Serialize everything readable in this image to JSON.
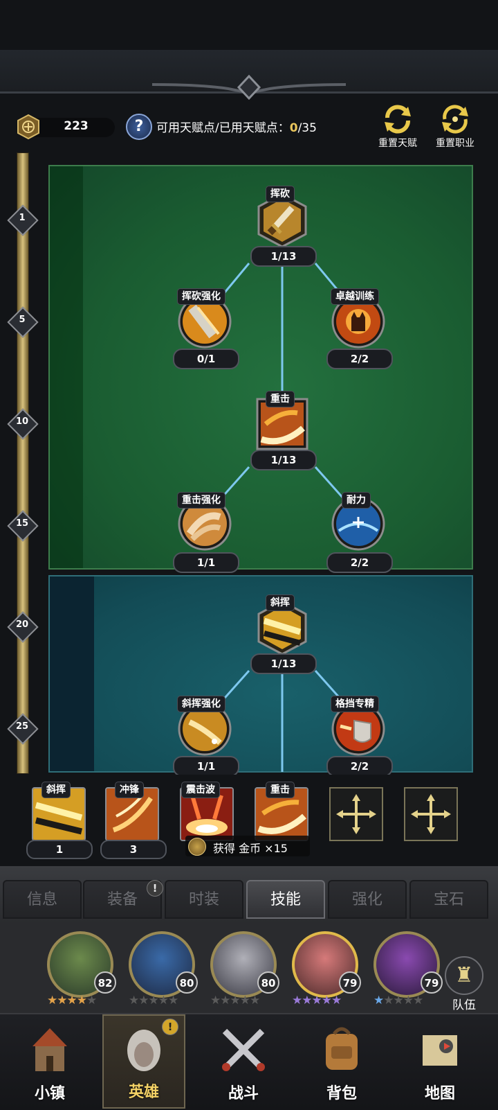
{
  "header": {
    "coins": "223",
    "points_label": "可用天赋点/已用天赋点：",
    "points_available": "0",
    "points_total": "/35",
    "reset_talent": "重置天赋",
    "reset_class": "重置职业"
  },
  "levels": [
    "1",
    "5",
    "10",
    "15",
    "20",
    "25"
  ],
  "tree": {
    "node1": {
      "name": "挥砍",
      "level": "1/13"
    },
    "node2": {
      "name": "挥砍强化",
      "level": "0/1"
    },
    "node3": {
      "name": "卓越训练",
      "level": "2/2"
    },
    "node4": {
      "name": "重击",
      "level": "1/13"
    },
    "node5": {
      "name": "重击强化",
      "level": "1/1"
    },
    "node6": {
      "name": "耐力",
      "level": "2/2"
    },
    "node7": {
      "name": "斜挥",
      "level": "1/13"
    },
    "node8": {
      "name": "斜挥强化",
      "level": "1/1"
    },
    "node9": {
      "name": "格挡专精",
      "level": "2/2"
    }
  },
  "skill_slots": [
    {
      "name": "斜挥",
      "count": "1"
    },
    {
      "name": "冲锋",
      "count": "3"
    },
    {
      "name": "震击波",
      "count": ""
    },
    {
      "name": "重击",
      "count": ""
    }
  ],
  "toast": {
    "text": "获得 金币 ×15"
  },
  "tabs": [
    {
      "label": "信息"
    },
    {
      "label": "装备"
    },
    {
      "label": "时装"
    },
    {
      "label": "技能"
    },
    {
      "label": "强化"
    },
    {
      "label": "宝石"
    }
  ],
  "tab_badge": "!",
  "heroes": [
    {
      "level": "82"
    },
    {
      "level": "80"
    },
    {
      "level": "80"
    },
    {
      "level": "79"
    },
    {
      "level": "79"
    }
  ],
  "team_label": "队伍",
  "nav": [
    {
      "label": "小镇"
    },
    {
      "label": "英雄"
    },
    {
      "label": "战斗"
    },
    {
      "label": "背包"
    },
    {
      "label": "地图"
    }
  ],
  "colors": {
    "green_panel": "#1a5c31",
    "teal_panel": "#134c56",
    "connector": "#7ec8ef",
    "gold": "#e9c65c"
  }
}
